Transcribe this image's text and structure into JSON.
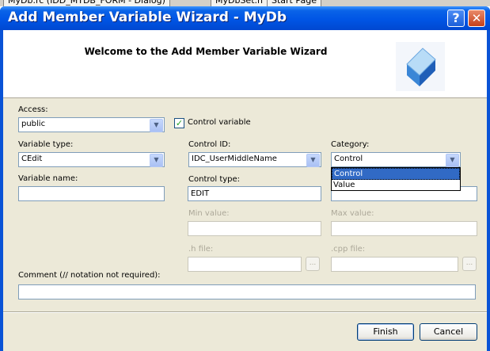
{
  "background_tabs": [
    "MyDb.rc (IDD_MYDB_FORM - Dialog)",
    "MyDbSet.h",
    "Start Page"
  ],
  "window": {
    "title": "Add Member Variable Wizard - MyDb",
    "help_glyph": "?",
    "close_glyph": "✕"
  },
  "header": {
    "welcome": "Welcome to the Add Member Variable Wizard",
    "logo_icon": "wizard-cube-icon"
  },
  "form": {
    "access_label": "Access:",
    "access_value": "public",
    "control_variable_label": "Control variable",
    "control_variable_checked": true,
    "variable_type_label": "Variable type:",
    "variable_type_value": "CEdit",
    "control_id_label": "Control ID:",
    "control_id_value": "IDC_UserMiddleName",
    "category_label": "Category:",
    "category_value": "Control",
    "category_options": [
      "Control",
      "Value"
    ],
    "category_selected": "Control",
    "variable_name_label": "Variable name:",
    "variable_name_value": "",
    "control_type_label": "Control type:",
    "control_type_value": "EDIT",
    "min_value_label": "Min value:",
    "max_value_label": "Max value:",
    "h_file_label": ".h file:",
    "cpp_file_label": ".cpp file:",
    "browse_label": "...",
    "comment_label": "Comment (// notation not required):",
    "comment_value": ""
  },
  "buttons": {
    "finish": "Finish",
    "cancel": "Cancel"
  },
  "colors": {
    "titlebar": "#0055e5",
    "dialog_bg": "#ece9d8",
    "selection": "#316ac5"
  }
}
